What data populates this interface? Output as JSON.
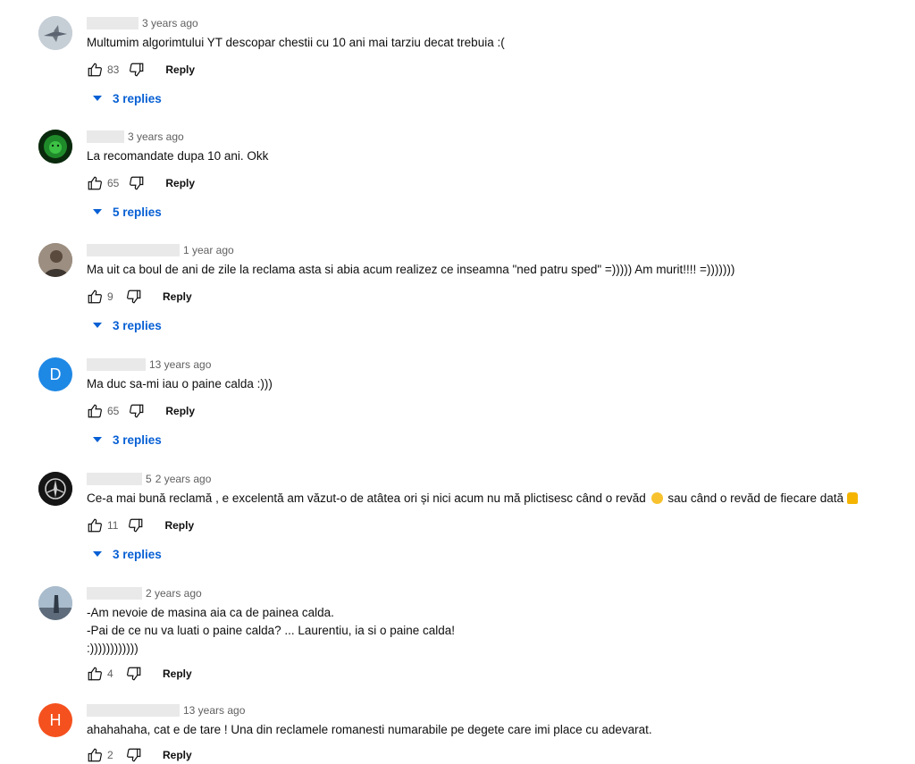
{
  "reply_label": "Reply",
  "comments": [
    {
      "time": "3 years ago",
      "text": "Multumim algorimtului YT descopar chestii cu 10 ani mai tarziu decat trebuia :(",
      "likes": "83",
      "replies": "3 replies"
    },
    {
      "time": "3 years ago",
      "text": "La recomandate dupa 10 ani. Okk",
      "likes": "65",
      "replies": "5 replies"
    },
    {
      "time": "1 year ago",
      "text": "Ma uit ca boul de ani de zile la reclama asta si abia acum realizez ce inseamna \"ned patru sped\" =))))) Am murit!!!! =)))))))",
      "likes": "9",
      "replies": "3 replies"
    },
    {
      "time": "13 years ago",
      "text": "Ma duc sa-mi iau o paine calda :)))",
      "likes": "65",
      "replies": "3 replies",
      "avatar_letter": "D"
    },
    {
      "time": "2 years ago",
      "text_a": "Ce-a mai bună reclamă , e excelentă am văzut-o de atâtea ori și nici acum nu mă plictisesc când o revăd",
      "text_b": "sau când o revăd de fiecare dată",
      "likes": "11",
      "replies": "3 replies",
      "author_suffix": "5"
    },
    {
      "time": "2 years ago",
      "text": "-Am nevoie de masina aia ca de painea calda.\n-Pai de ce nu va luati o paine calda? ... Laurentiu, ia si o paine calda!\n:))))))))))))",
      "likes": "4"
    },
    {
      "time": "13 years ago",
      "text": "ahahahaha, cat e de tare ! Una din reclamele romanesti numarabile pe degete care imi place cu adevarat.",
      "likes": "2",
      "avatar_letter": "H"
    }
  ],
  "colors": {
    "accent": "#065fd4",
    "avatar_d": "#1e88e5",
    "avatar_h": "#f4511e"
  }
}
